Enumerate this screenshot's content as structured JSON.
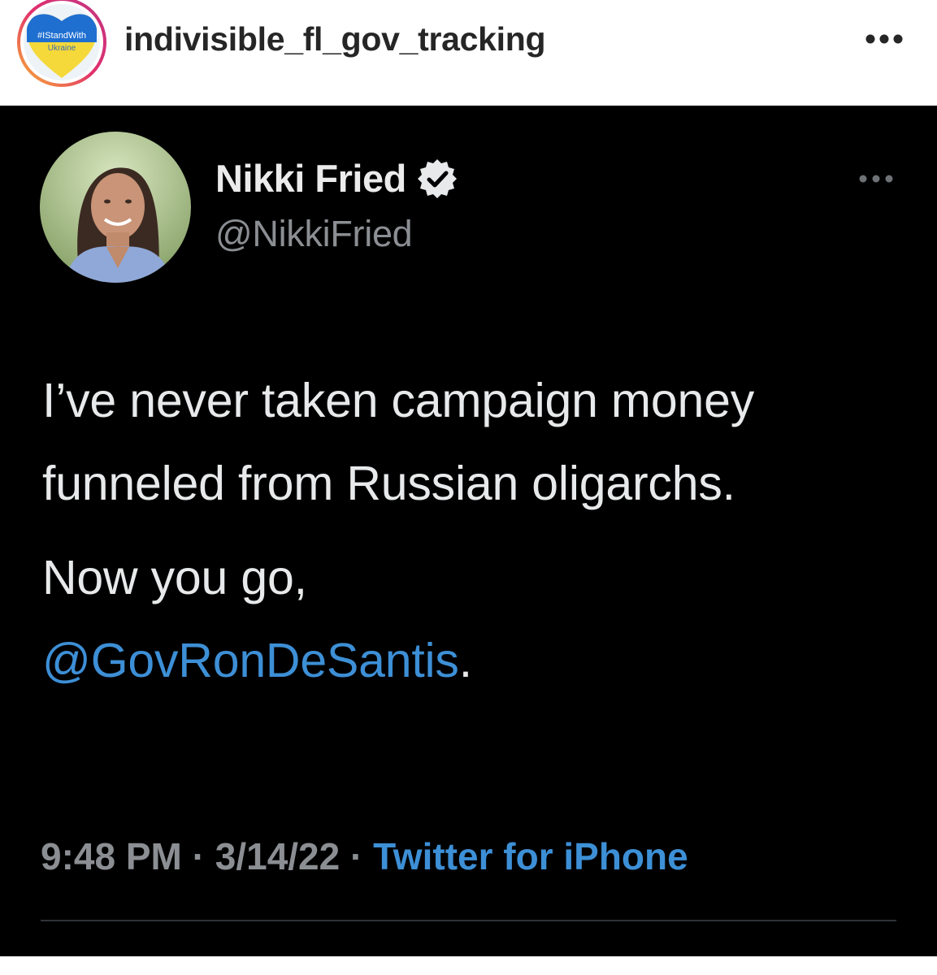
{
  "instagram": {
    "username": "indivisible_fl_gov_tracking",
    "avatar_text_top": "#IStandWith",
    "avatar_text_bottom": "Ukraine",
    "more_icon": "more-horizontal-icon",
    "colors": {
      "flag_blue": "#1f6fd1",
      "flag_yellow": "#f5d83a"
    }
  },
  "tweet": {
    "display_name": "Nikki Fried",
    "handle": "@NikkiFried",
    "verified": true,
    "text_paragraph_1": "I’ve never taken campaign money funneled from Russian oligarchs.",
    "text_paragraph_2_prefix": "Now you go, ",
    "mention": "@GovRonDeSantis",
    "text_paragraph_2_suffix": ".",
    "time": "9:48 PM",
    "date": "3/14/22",
    "source": "Twitter for iPhone",
    "separator": " · ",
    "colors": {
      "background": "#000000",
      "link": "#3d8fd6",
      "secondary": "#8b8e92"
    }
  }
}
